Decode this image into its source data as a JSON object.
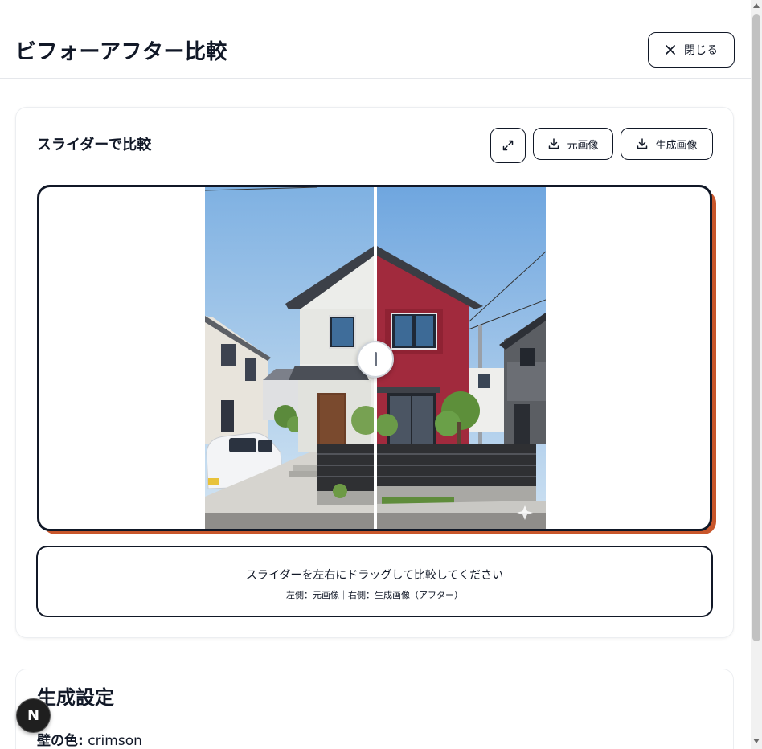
{
  "header": {
    "title": "ビフォーアフター比較",
    "close_label": "閉じる"
  },
  "compare_card": {
    "title": "スライダーで比較",
    "buttons": {
      "original_label": "元画像",
      "generated_label": "生成画像"
    },
    "slider_position": 0.5,
    "info_main": "スライダーを左右にドラッグして比較してください",
    "info_sub": "左側：元画像｜右側：生成画像（アフター）"
  },
  "settings": {
    "title": "生成設定",
    "wall_color_label": "壁の色:",
    "wall_color_value": "crimson"
  },
  "avatar": {
    "initial": "N"
  },
  "colors": {
    "accent_shadow": "#c8562b",
    "dark": "#111827",
    "wall_before": "#e9ebe7",
    "wall_after": "#a12a3d"
  },
  "icons": [
    "close-icon",
    "expand-icon",
    "download-icon",
    "slider-grip-icon"
  ]
}
